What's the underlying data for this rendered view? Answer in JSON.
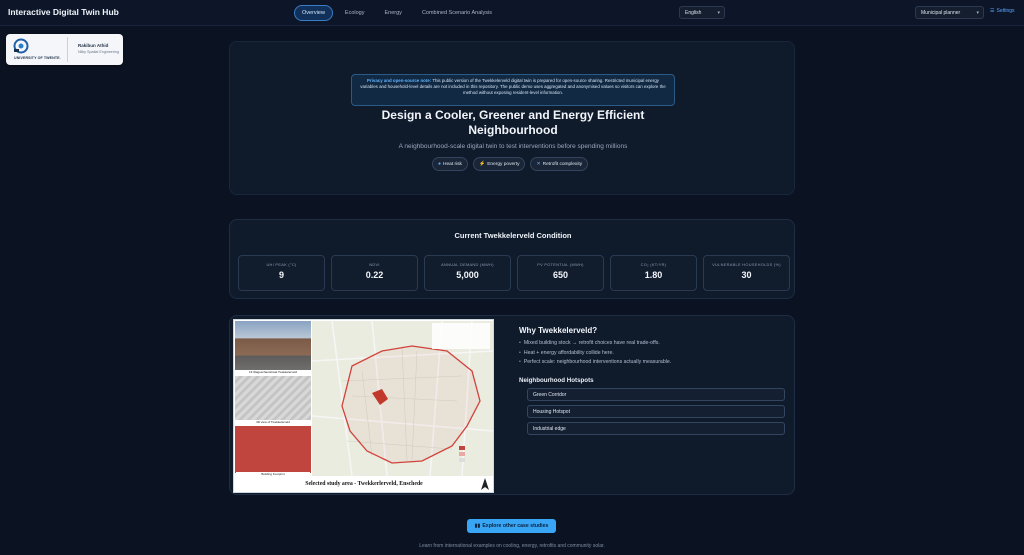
{
  "header": {
    "app_title": "Interactive Digital Twin Hub",
    "tabs": [
      {
        "label": "Overview",
        "active": true
      },
      {
        "label": "Ecology",
        "active": false
      },
      {
        "label": "Energy",
        "active": false
      },
      {
        "label": "Combined Scenario Analysis",
        "active": false
      }
    ],
    "language": "English",
    "role": "Municipal planner",
    "settings_label": "Settings"
  },
  "affiliation": {
    "university": "UNIVERSITY OF TWENTE.",
    "person_name": "Rakibun Athid",
    "person_role": "Nilky Spatial Engineering"
  },
  "hero": {
    "notice_lead": "Privacy and open-source note:",
    "notice_body": "This public version of the Twekkelerveld digital twin is prepared for open-source sharing. Restricted municipal energy variables and household-level details are not included in this repository. The public demo uses aggregated and anonymised values so visitors can explore the method without exposing resident-level information.",
    "title_line1": "Design a Cooler, Greener and Energy Efficient",
    "title_line2": "Neighbourhood",
    "subtitle": "A neighbourhood-scale digital twin to test interventions before spending millions",
    "chips": [
      {
        "icon": "droplet-icon",
        "label": "Heat risk"
      },
      {
        "icon": "bolt-icon",
        "label": "Energy poverty"
      },
      {
        "icon": "tools-icon",
        "label": "Retrofit complexity"
      }
    ]
  },
  "condition": {
    "title": "Current Twekkelerveld Condition",
    "metrics": [
      {
        "label": "UHI PEAK (°C)",
        "value": "9"
      },
      {
        "label": "NDVI",
        "value": "0.22"
      },
      {
        "label": "ANNUAL DEMAND (MWH)",
        "value": "5,000"
      },
      {
        "label": "PV POTENTIAL (MWH)",
        "value": "650"
      },
      {
        "label": "CO₂ (KT/YR)",
        "value": "1.80"
      },
      {
        "label": "VULNERABLE HOUSEHOLDS (%)",
        "value": "30"
      }
    ]
  },
  "study_area": {
    "photo_captions": [
      "19 Wageschautstraat Twekkelerveld",
      "3D view of Twekkelerveld",
      "Building Footprint"
    ],
    "map_caption": "Selected study area - Twekkerlerveld, Enschede",
    "why_title": "Why Twekkelerveld?",
    "why_points": [
      "Mixed building stock → retrofit choices have real trade-offs.",
      "Heat + energy affordability collide here.",
      "Perfect scale: neighbourhood interventions actually measurable."
    ],
    "hotspots_title": "Neighbourhood Hotspots",
    "hotspots": [
      "Green Corridor",
      "Housing Hotspot",
      "Industrial edge"
    ]
  },
  "footer": {
    "explore_label": "Explore other case studies",
    "note": "Learn from international examples on cooling, energy, retrofits and community solar."
  }
}
